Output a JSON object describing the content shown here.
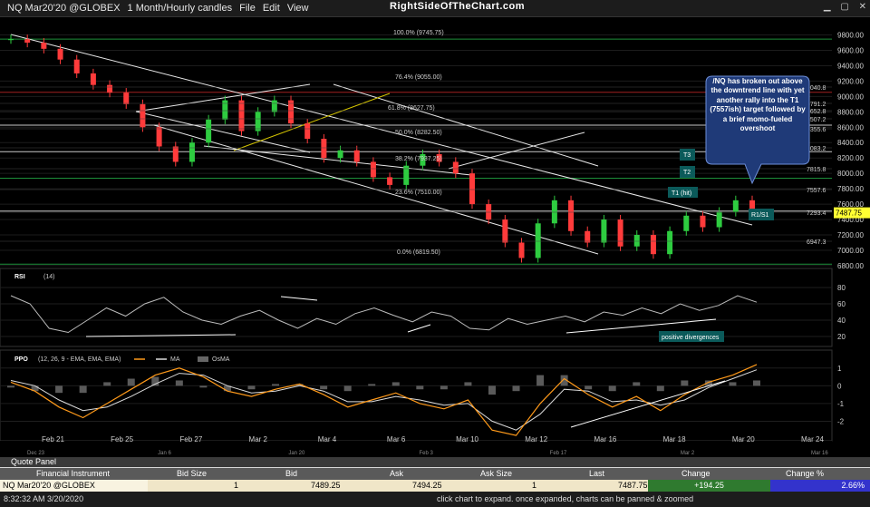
{
  "toolbar": {
    "symbol": "NQ Mar20'20 @GLOBEX",
    "timeframe": "1 Month/Hourly candles",
    "menu": [
      "File",
      "Edit",
      "View"
    ],
    "brand": "RightSideOfTheChart.com"
  },
  "annotation": "/NQ has broken out above the downtrend line with yet another rally into the T1 (7557ish) target followed by a brief momo-fueled overshoot",
  "labels": {
    "fib100": "100.0% (9745.75)",
    "fib764": "76.4% (9055.00)",
    "fib618": "61.8% (8627.75)",
    "fib50": "50.0% (8282.50)",
    "fib382": "38.2% (7937.25)",
    "fib236": "23.6% (7510.00)",
    "fib0": "0.0% (6819.50)",
    "t3": "T3",
    "t2": "T2",
    "t1": "T1 (hit)",
    "r1s1": "R1/S1",
    "pos_div": "positive divergences",
    "rsi": "RSI",
    "rsi_param": "(14)",
    "ppo": "PPO",
    "ppo_param": "(12, 26, 9 - EMA, EMA, EMA)",
    "ma": "MA",
    "osma": "OsMA"
  },
  "colors": {
    "candle": "#2ecc40",
    "candle_down": "#ff3b3b",
    "trendline": "#e8e8e8",
    "fib": "#c8c8c8",
    "fib_green": "#1d8f3a",
    "fib_red": "#a02020",
    "price_tag": "#ffff33",
    "annotation_bg": "#1f3a78"
  },
  "chart_data": [
    {
      "type": "candlestick",
      "title": "NQ Mar20'20 @GLOBEX 1 Month/Hourly candles",
      "x_ticks": [
        "Feb 21",
        "Feb 25",
        "Feb 27",
        "Mar 2",
        "Mar 4",
        "Mar 6",
        "Mar 10",
        "Mar 12",
        "Mar 16",
        "Mar 18",
        "Mar 20",
        "Mar 24"
      ],
      "x_ticks_long": [
        "Dec 23",
        "Jan 6",
        "Jan 20",
        "Feb 3",
        "Feb 17",
        "Mar 2",
        "Mar 16"
      ],
      "y_ticks": [
        9800,
        9600,
        9400,
        9200,
        9000,
        8800,
        8600,
        8400,
        8200,
        8000,
        7800,
        7600,
        7400,
        7200,
        7000,
        6800
      ],
      "ylim": [
        6740,
        9830
      ],
      "right_axis_levels": [
        "9040.8",
        "8791.2",
        "8652.8",
        "8507.2",
        "8355.6",
        "8083.2",
        "7815.8",
        "7557.6",
        "7293.4",
        "6947.3"
      ],
      "last_price": "7487.75",
      "fib_levels": [
        9745.75,
        9055.0,
        8627.75,
        8282.5,
        7937.25,
        7510.0,
        6819.5
      ],
      "closes": [
        9745,
        9700,
        9620,
        9480,
        9300,
        9150,
        9050,
        8900,
        8600,
        8350,
        8150,
        8400,
        8700,
        8950,
        8550,
        8800,
        8950,
        8650,
        8450,
        8200,
        8300,
        8150,
        7950,
        7850,
        8100,
        8250,
        8150,
        8000,
        7600,
        7400,
        7100,
        6900,
        7350,
        7650,
        7250,
        7100,
        7400,
        7050,
        7200,
        6950,
        7250,
        7450,
        7300,
        7500,
        7650,
        7487
      ]
    },
    {
      "type": "line",
      "title": "RSI (14)",
      "y_ticks": [
        80,
        60,
        40,
        20
      ],
      "ylim": [
        10,
        90
      ],
      "values": [
        70,
        60,
        30,
        25,
        40,
        55,
        45,
        60,
        68,
        50,
        40,
        35,
        45,
        52,
        40,
        30,
        42,
        35,
        48,
        55,
        46,
        38,
        50,
        45,
        30,
        28,
        42,
        35,
        40,
        45,
        38,
        50,
        46,
        55,
        48,
        60,
        52,
        58,
        70,
        62
      ]
    },
    {
      "type": "line",
      "title": "PPO (12, 26, 9 - EMA, EMA, EMA)",
      "y_ticks": [
        1,
        0,
        -1,
        -2
      ],
      "ylim": [
        -3,
        1.5
      ],
      "series": [
        {
          "name": "PPO",
          "values": [
            0.2,
            -0.3,
            -1.2,
            -1.8,
            -1.0,
            -0.2,
            0.6,
            1.0,
            0.5,
            -0.3,
            -0.6,
            -0.2,
            0.1,
            -0.5,
            -1.2,
            -0.8,
            -0.4,
            -1.0,
            -1.3,
            -0.8,
            -2.5,
            -2.8,
            -1.0,
            0.4,
            -0.5,
            -1.2,
            -0.6,
            -1.4,
            -0.5,
            0.2,
            0.6,
            1.2
          ]
        },
        {
          "name": "MA",
          "values": [
            0.3,
            0.0,
            -0.8,
            -1.4,
            -1.2,
            -0.6,
            0.1,
            0.7,
            0.6,
            0.0,
            -0.4,
            -0.3,
            0.0,
            -0.3,
            -0.9,
            -0.9,
            -0.6,
            -0.8,
            -1.1,
            -1.0,
            -2.0,
            -2.5,
            -1.6,
            -0.2,
            -0.3,
            -0.9,
            -0.8,
            -1.1,
            -0.8,
            -0.1,
            0.4,
            0.9
          ]
        }
      ]
    }
  ],
  "quote_panel": {
    "title": "Quote Panel",
    "headers": [
      "Financial Instrument",
      "Bid Size",
      "Bid",
      "Ask",
      "Ask Size",
      "Last",
      "Change",
      "Change %"
    ],
    "row": [
      "NQ Mar20'20 @GLOBEX",
      "1",
      "7489.25",
      "7494.25",
      "1",
      "7487.75",
      "+194.25",
      "2.66%"
    ]
  },
  "status": {
    "time": "8:32:32 AM 3/20/2020",
    "hint": "click chart to expand. once expanded, charts can be panned & zoomed"
  }
}
